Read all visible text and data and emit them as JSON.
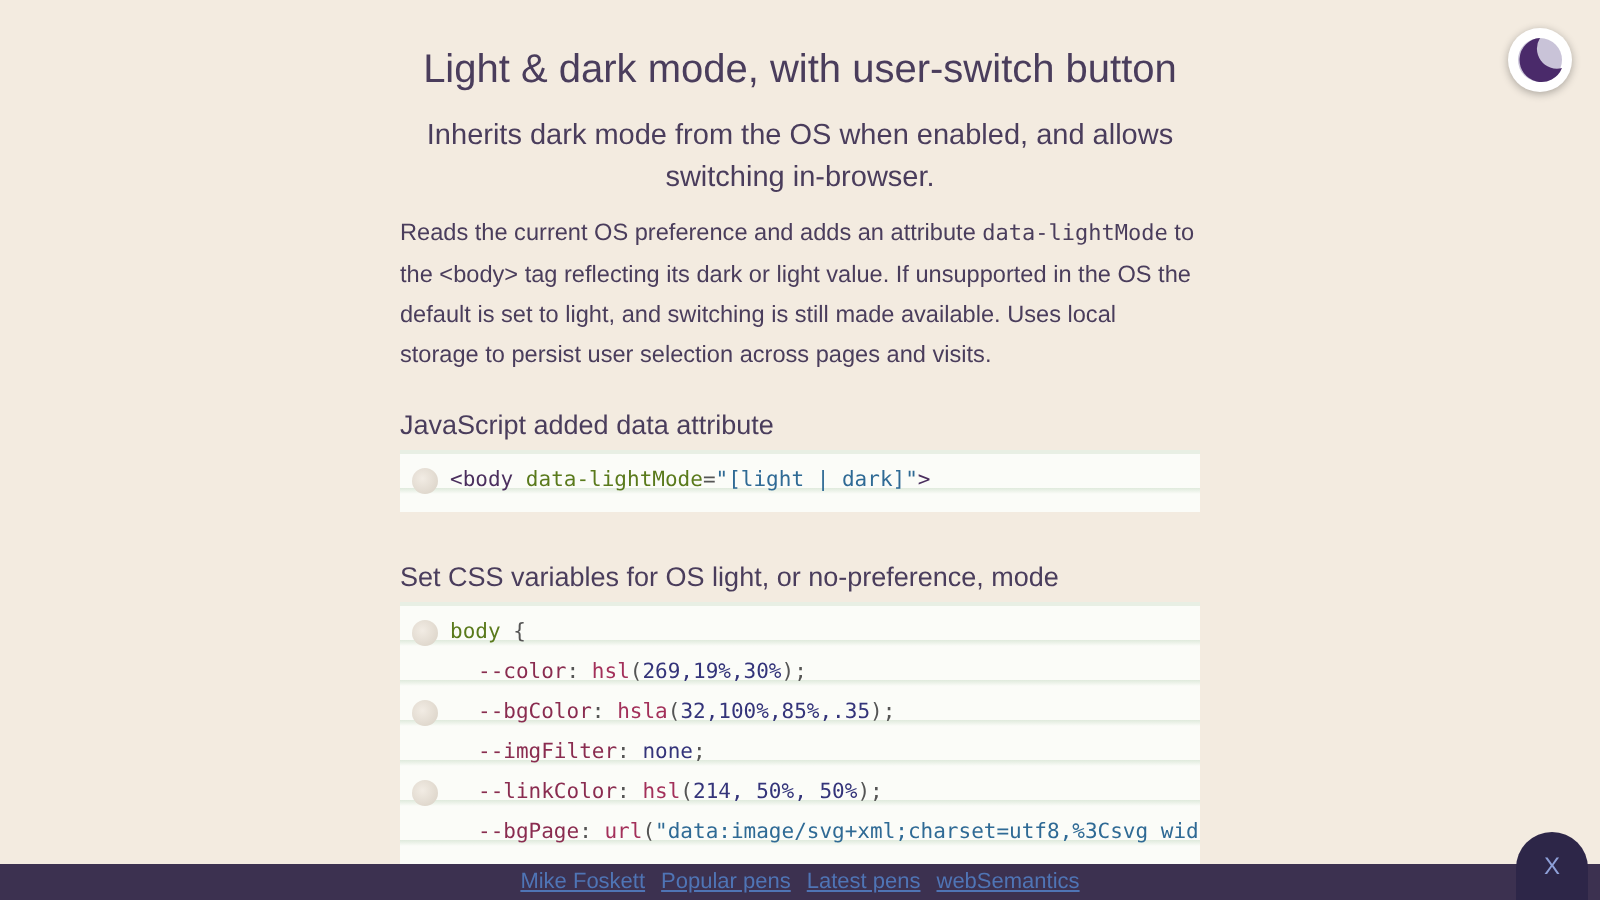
{
  "title": "Light & dark mode, with user-switch button",
  "subtitle": "Inherits dark mode from the OS when enabled, and allows switching in-browser.",
  "intro": [
    {
      "kind": "text",
      "text": "Reads the current OS preference and adds an attribute "
    },
    {
      "kind": "code",
      "text": "data-lightMode"
    },
    {
      "kind": "text",
      "text": " to the <body> tag reflecting its dark or light value. If unsupported in the OS the default is set to light, and switching is still made available. Uses local storage to persist user selection across pages and visits."
    }
  ],
  "sections": [
    {
      "heading": "JavaScript added data attribute",
      "lines": [
        {
          "marker": true,
          "indent": false,
          "tokens": [
            {
              "kind": "tag",
              "text": "<body"
            },
            {
              "kind": "attr",
              "text": " data-lightMode"
            },
            {
              "kind": "punct",
              "text": "="
            },
            {
              "kind": "string",
              "text": "\"[light | dark]\""
            },
            {
              "kind": "tag",
              "text": ">"
            }
          ]
        }
      ]
    },
    {
      "heading": "Set CSS variables for OS light, or no-preference, mode",
      "lines": [
        {
          "marker": true,
          "indent": false,
          "tokens": [
            {
              "kind": "attr",
              "text": "body"
            },
            {
              "kind": "punct",
              "text": " {"
            }
          ]
        },
        {
          "marker": false,
          "indent": true,
          "tokens": [
            {
              "kind": "prop",
              "text": "--color"
            },
            {
              "kind": "punct",
              "text": ": "
            },
            {
              "kind": "func",
              "text": "hsl"
            },
            {
              "kind": "punct",
              "text": "("
            },
            {
              "kind": "number",
              "text": "269,19%,30%"
            },
            {
              "kind": "punct",
              "text": ");"
            }
          ]
        },
        {
          "marker": true,
          "indent": true,
          "tokens": [
            {
              "kind": "prop",
              "text": "--bgColor"
            },
            {
              "kind": "punct",
              "text": ": "
            },
            {
              "kind": "func",
              "text": "hsla"
            },
            {
              "kind": "punct",
              "text": "("
            },
            {
              "kind": "number",
              "text": "32,100%,85%,.35"
            },
            {
              "kind": "punct",
              "text": ");"
            }
          ]
        },
        {
          "marker": false,
          "indent": true,
          "tokens": [
            {
              "kind": "prop",
              "text": "--imgFilter"
            },
            {
              "kind": "punct",
              "text": ": "
            },
            {
              "kind": "number",
              "text": "none"
            },
            {
              "kind": "punct",
              "text": ";"
            }
          ]
        },
        {
          "marker": true,
          "indent": true,
          "tokens": [
            {
              "kind": "prop",
              "text": "--linkColor"
            },
            {
              "kind": "punct",
              "text": ": "
            },
            {
              "kind": "func",
              "text": "hsl"
            },
            {
              "kind": "punct",
              "text": "("
            },
            {
              "kind": "number",
              "text": "214, 50%, 50%"
            },
            {
              "kind": "punct",
              "text": ");"
            }
          ]
        },
        {
          "marker": false,
          "indent": true,
          "tokens": [
            {
              "kind": "prop",
              "text": "--bgPage"
            },
            {
              "kind": "punct",
              "text": ": "
            },
            {
              "kind": "func",
              "text": "url"
            },
            {
              "kind": "punct",
              "text": "("
            },
            {
              "kind": "string",
              "text": "\"data:image/svg+xml;charset=utf8,%3Csvg wid"
            }
          ]
        }
      ]
    }
  ],
  "footer_links": [
    "Mike Foskett",
    "Popular pens",
    "Latest pens",
    "webSemantics"
  ],
  "close_button": "X"
}
